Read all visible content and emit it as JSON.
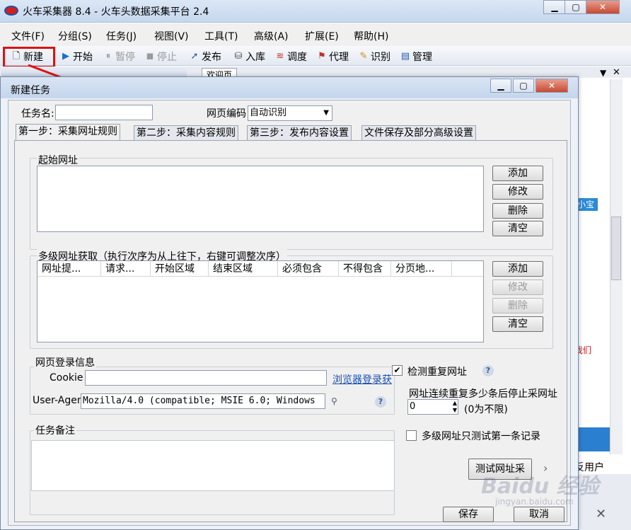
{
  "app": {
    "title": "火车采集器 8.4 - 火车头数据采集平台 2.4"
  },
  "menu": [
    "文件(F)",
    "分组(S)",
    "任务(J)",
    "视图(V)",
    "工具(T)",
    "高级(A)",
    "扩展(E)",
    "帮助(H)"
  ],
  "toolbar": {
    "new": "新建",
    "start": "开始",
    "pause": "暂停",
    "stop": "停止",
    "publish": "发布",
    "import": "入库",
    "schedule": "调度",
    "proxy": "代理",
    "recognize": "识别",
    "manage": "管理"
  },
  "background": {
    "welcome_tab": "欢迎页",
    "badge": "小宝",
    "red_text": "我们",
    "user_text": "反用户"
  },
  "dialog": {
    "title": "新建任务",
    "task_name_label": "任务名:",
    "task_name_value": "",
    "encoding_label": "网页编码",
    "encoding_value": "自动识别",
    "tabs": [
      "第一步：采集网址规则",
      "第二步：采集内容规则",
      "第三步：发布内容设置",
      "文件保存及部分高级设置"
    ],
    "start_url": {
      "label": "起始网址",
      "buttons": [
        "添加",
        "修改",
        "删除",
        "清空"
      ]
    },
    "multi_url": {
      "label": "多级网址获取（执行次序为从上往下，右键可调整次序）",
      "columns": [
        "网址提...",
        "请求...",
        "开始区域",
        "结束区域",
        "必须包含",
        "不得包含",
        "分页地..."
      ],
      "buttons": [
        "添加",
        "修改",
        "删除",
        "清空"
      ]
    },
    "login": {
      "label": "网页登录信息",
      "cookie_label": "Cookie",
      "cookie_value": "",
      "browser_login": "浏览器登录获",
      "ua_label": "User-Agent",
      "ua_value": "Mozilla/4.0 (compatible; MSIE 6.0; Windows"
    },
    "check_dup": {
      "label": "检测重复网址",
      "checked": true
    },
    "stop_repeat_label": "网址连续重复多少条后停止采网址",
    "stop_repeat_value": "0",
    "stop_repeat_hint": "(0为不限)",
    "multi_first_only": {
      "label": "多级网址只测试第一条记录",
      "checked": false
    },
    "notes_label": "任务备注",
    "test_button": "测试网址采",
    "save_button": "保存",
    "cancel_button": "取消"
  },
  "watermark": {
    "main": "Baidu 经验",
    "sub": "jingyan.baidu.com"
  }
}
